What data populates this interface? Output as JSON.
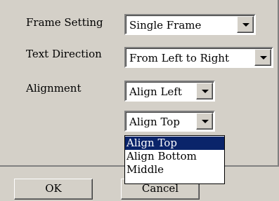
{
  "fields": [
    {
      "label": "Frame Setting",
      "value": "Single Frame"
    },
    {
      "label": "Text Direction",
      "value": "From Left to Right"
    },
    {
      "label": "Alignment",
      "value": "Align Left"
    }
  ],
  "vertical_alignment": {
    "value": "Align Top"
  },
  "dropdown": {
    "options": [
      "Align Top",
      "Align Bottom",
      "Middle"
    ],
    "selected_index": 0
  },
  "buttons": {
    "ok_label": "OK",
    "cancel_label": "Cancel"
  },
  "colors": {
    "highlight": "#0a246a",
    "face": "#d4d0c8"
  }
}
